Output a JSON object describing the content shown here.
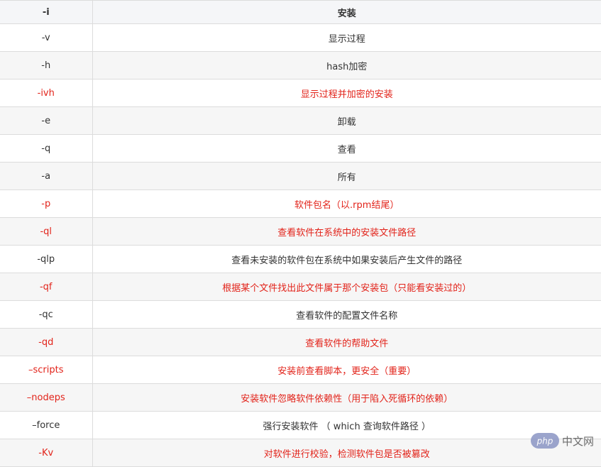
{
  "header": {
    "col1": "-i",
    "col2": "安装"
  },
  "colors": {
    "highlight": "#e2231a",
    "normal": "#333333",
    "stripe": "#f6f6f6"
  },
  "rows": [
    {
      "option": "-v",
      "desc": "显示过程",
      "highlight": false
    },
    {
      "option": "-h",
      "desc": "hash加密",
      "highlight": false
    },
    {
      "option": "-ivh",
      "desc": "显示过程并加密的安装",
      "highlight": true
    },
    {
      "option": "-e",
      "desc": "卸载",
      "highlight": false
    },
    {
      "option": "-q",
      "desc": "查看",
      "highlight": false
    },
    {
      "option": "-a",
      "desc": "所有",
      "highlight": false
    },
    {
      "option": "-p",
      "desc": "软件包名（以.rpm结尾）",
      "highlight": true
    },
    {
      "option": "-ql",
      "desc": "查看软件在系统中的安装文件路径",
      "highlight": true
    },
    {
      "option": "-qlp",
      "desc": "查看未安装的软件包在系统中如果安装后产生文件的路径",
      "highlight": false
    },
    {
      "option": "-qf",
      "desc": "根据某个文件找出此文件属于那个安装包（只能看安装过的）",
      "highlight": true
    },
    {
      "option": "-qc",
      "desc": "查看软件的配置文件名称",
      "highlight": false
    },
    {
      "option": "-qd",
      "desc": "查看软件的帮助文件",
      "highlight": true
    },
    {
      "option": "–scripts",
      "desc": "安装前查看脚本，更安全（重要）",
      "highlight": true
    },
    {
      "option": "–nodeps",
      "desc": "安装软件忽略软件依赖性（用于陷入死循环的依赖）",
      "highlight": true
    },
    {
      "option": "–force",
      "desc": "强行安装软件 （ which 查询软件路径 ）",
      "highlight": false
    },
    {
      "option": "-Kv",
      "desc": "对软件进行校验，检测软件包是否被篡改",
      "highlight": true
    }
  ],
  "watermark": {
    "logo_text": "php",
    "text": "中文网"
  }
}
